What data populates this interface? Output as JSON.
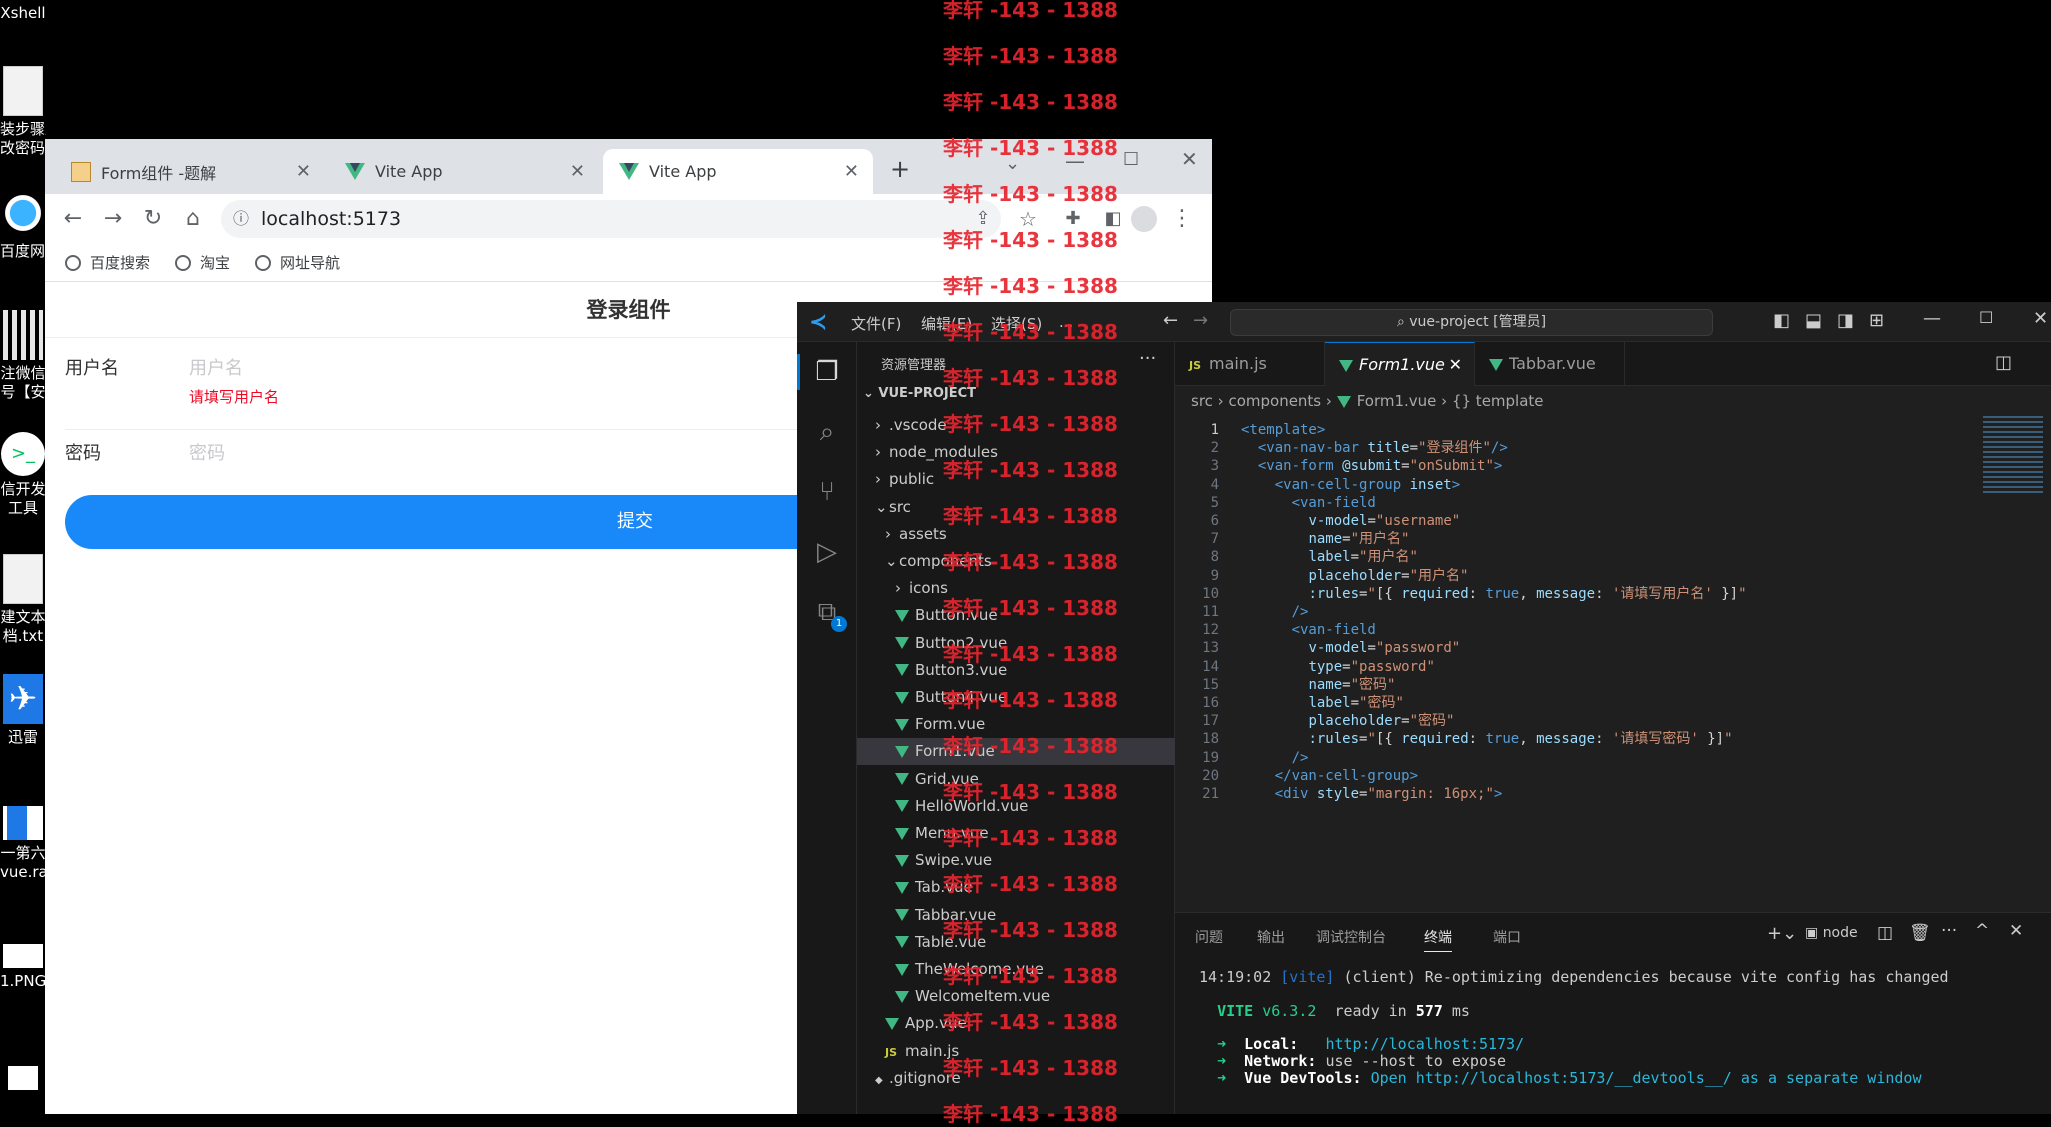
{
  "desktop": {
    "icons": [
      {
        "label": "Xshell",
        "top": 0
      },
      {
        "label": "装步骤及",
        "top": 0
      },
      {
        "label": "改密码.",
        "top": 0
      },
      {
        "label": "百度网盘",
        "top": 0
      },
      {
        "label": "注微信",
        "top": 0
      },
      {
        "label": "号【安",
        "top": 0
      },
      {
        "label": "信开发",
        "top": 0
      },
      {
        "label": "工具",
        "top": 0
      },
      {
        "label": "建文本",
        "top": 0
      },
      {
        "label": "档.txt",
        "top": 0
      },
      {
        "label": "迅雷",
        "top": 0
      },
      {
        "label": "一第六",
        "top": 0
      },
      {
        "label": "vue.rar",
        "top": 0
      },
      {
        "label": "1.PNG",
        "top": 0
      }
    ]
  },
  "browser": {
    "tabs": [
      {
        "title": "Form组件 -题解"
      },
      {
        "title": "Vite App"
      },
      {
        "title": "Vite App"
      }
    ],
    "url": "localhost:5173",
    "bookmarks": [
      "百度搜索",
      "淘宝",
      "网址导航"
    ],
    "page": {
      "navbar_title": "登录组件",
      "username_label": "用户名",
      "username_placeholder": "用户名",
      "username_error": "请填写用户名",
      "password_label": "密码",
      "password_placeholder": "密码",
      "submit_label": "提交"
    }
  },
  "vscode": {
    "menu": [
      "文件(F)",
      "编辑(E)",
      "选择(S)",
      "..."
    ],
    "search_text": "vue-project [管理员]",
    "explorer_title": "资源管理器",
    "project_name": "VUE-PROJECT",
    "tree": [
      {
        "label": ".vscode",
        "depth": 1,
        "kind": "folder",
        "open": false
      },
      {
        "label": "node_modules",
        "depth": 1,
        "kind": "folder",
        "open": false
      },
      {
        "label": "public",
        "depth": 1,
        "kind": "folder",
        "open": false
      },
      {
        "label": "src",
        "depth": 1,
        "kind": "folder",
        "open": true
      },
      {
        "label": "assets",
        "depth": 2,
        "kind": "folder",
        "open": false
      },
      {
        "label": "components",
        "depth": 2,
        "kind": "folder",
        "open": true
      },
      {
        "label": "icons",
        "depth": 3,
        "kind": "folder",
        "open": false
      },
      {
        "label": "Button.vue",
        "depth": 3,
        "kind": "vue"
      },
      {
        "label": "Button2.vue",
        "depth": 3,
        "kind": "vue"
      },
      {
        "label": "Button3.vue",
        "depth": 3,
        "kind": "vue"
      },
      {
        "label": "Button4.vue",
        "depth": 3,
        "kind": "vue"
      },
      {
        "label": "Form.vue",
        "depth": 3,
        "kind": "vue"
      },
      {
        "label": "Form1.vue",
        "depth": 3,
        "kind": "vue",
        "selected": true
      },
      {
        "label": "Grid.vue",
        "depth": 3,
        "kind": "vue"
      },
      {
        "label": "HelloWorld.vue",
        "depth": 3,
        "kind": "vue"
      },
      {
        "label": "Menu.vue",
        "depth": 3,
        "kind": "vue"
      },
      {
        "label": "Swipe.vue",
        "depth": 3,
        "kind": "vue"
      },
      {
        "label": "Tab.vue",
        "depth": 3,
        "kind": "vue"
      },
      {
        "label": "Tabbar.vue",
        "depth": 3,
        "kind": "vue"
      },
      {
        "label": "Table.vue",
        "depth": 3,
        "kind": "vue"
      },
      {
        "label": "TheWelcome.vue",
        "depth": 3,
        "kind": "vue"
      },
      {
        "label": "WelcomeItem.vue",
        "depth": 3,
        "kind": "vue"
      },
      {
        "label": "App.vue",
        "depth": 2,
        "kind": "vue"
      },
      {
        "label": "main.js",
        "depth": 2,
        "kind": "js"
      },
      {
        "label": ".gitignore",
        "depth": 1,
        "kind": "file"
      }
    ],
    "editor_tabs": [
      {
        "label": "main.js",
        "kind": "js"
      },
      {
        "label": "Form1.vue",
        "kind": "vue",
        "active": true
      },
      {
        "label": "Tabbar.vue",
        "kind": "vue"
      }
    ],
    "breadcrumb": [
      "src",
      "components",
      "Form1.vue",
      "{} template"
    ],
    "code_lines": [
      [
        [
          "tg",
          "<template>"
        ]
      ],
      [
        [
          "pu",
          "  "
        ],
        [
          "tg",
          "<van-nav-bar "
        ],
        [
          "at",
          "title"
        ],
        [
          "ck",
          "="
        ],
        [
          "st",
          "\"登录组件\""
        ],
        [
          "tg",
          "/>"
        ]
      ],
      [
        [
          "pu",
          "  "
        ],
        [
          "tg",
          "<van-form "
        ],
        [
          "at",
          "@submit"
        ],
        [
          "ck",
          "="
        ],
        [
          "st",
          "\"onSubmit\""
        ],
        [
          "tg",
          ">"
        ]
      ],
      [
        [
          "pu",
          "    "
        ],
        [
          "tg",
          "<van-cell-group "
        ],
        [
          "at",
          "inset"
        ],
        [
          "tg",
          ">"
        ]
      ],
      [
        [
          "pu",
          "      "
        ],
        [
          "tg",
          "<van-field"
        ]
      ],
      [
        [
          "pu",
          "        "
        ],
        [
          "at",
          "v-model"
        ],
        [
          "ck",
          "="
        ],
        [
          "st",
          "\"username\""
        ]
      ],
      [
        [
          "pu",
          "        "
        ],
        [
          "at",
          "name"
        ],
        [
          "ck",
          "="
        ],
        [
          "st",
          "\"用户名\""
        ]
      ],
      [
        [
          "pu",
          "        "
        ],
        [
          "at",
          "label"
        ],
        [
          "ck",
          "="
        ],
        [
          "st",
          "\"用户名\""
        ]
      ],
      [
        [
          "pu",
          "        "
        ],
        [
          "at",
          "placeholder"
        ],
        [
          "ck",
          "="
        ],
        [
          "st",
          "\"用户名\""
        ]
      ],
      [
        [
          "pu",
          "        "
        ],
        [
          "at",
          ":rules"
        ],
        [
          "ck",
          "="
        ],
        [
          "st",
          "\""
        ],
        [
          "ck",
          "[{ "
        ],
        [
          "at",
          "required"
        ],
        [
          "ck",
          ": "
        ],
        [
          "kw",
          "true"
        ],
        [
          "ck",
          ", "
        ],
        [
          "at",
          "message"
        ],
        [
          "ck",
          ": "
        ],
        [
          "st",
          "'请填写用户名'"
        ],
        [
          "ck",
          " }]"
        ],
        [
          "st",
          "\""
        ]
      ],
      [
        [
          "pu",
          "      "
        ],
        [
          "tg",
          "/>"
        ]
      ],
      [
        [
          "pu",
          "      "
        ],
        [
          "tg",
          "<van-field"
        ]
      ],
      [
        [
          "pu",
          "        "
        ],
        [
          "at",
          "v-model"
        ],
        [
          "ck",
          "="
        ],
        [
          "st",
          "\"password\""
        ]
      ],
      [
        [
          "pu",
          "        "
        ],
        [
          "at",
          "type"
        ],
        [
          "ck",
          "="
        ],
        [
          "st",
          "\"password\""
        ]
      ],
      [
        [
          "pu",
          "        "
        ],
        [
          "at",
          "name"
        ],
        [
          "ck",
          "="
        ],
        [
          "st",
          "\"密码\""
        ]
      ],
      [
        [
          "pu",
          "        "
        ],
        [
          "at",
          "label"
        ],
        [
          "ck",
          "="
        ],
        [
          "st",
          "\"密码\""
        ]
      ],
      [
        [
          "pu",
          "        "
        ],
        [
          "at",
          "placeholder"
        ],
        [
          "ck",
          "="
        ],
        [
          "st",
          "\"密码\""
        ]
      ],
      [
        [
          "pu",
          "        "
        ],
        [
          "at",
          ":rules"
        ],
        [
          "ck",
          "="
        ],
        [
          "st",
          "\""
        ],
        [
          "ck",
          "[{ "
        ],
        [
          "at",
          "required"
        ],
        [
          "ck",
          ": "
        ],
        [
          "kw",
          "true"
        ],
        [
          "ck",
          ", "
        ],
        [
          "at",
          "message"
        ],
        [
          "ck",
          ": "
        ],
        [
          "st",
          "'请填写密码'"
        ],
        [
          "ck",
          " }]"
        ],
        [
          "st",
          "\""
        ]
      ],
      [
        [
          "pu",
          "      "
        ],
        [
          "tg",
          "/>"
        ]
      ],
      [
        [
          "pu",
          "    "
        ],
        [
          "tg",
          "</van-cell-group>"
        ]
      ],
      [
        [
          "pu",
          "    "
        ],
        [
          "tg",
          "<div "
        ],
        [
          "at",
          "style"
        ],
        [
          "ck",
          "="
        ],
        [
          "st",
          "\"margin: 16px;\""
        ],
        [
          "tg",
          ">"
        ]
      ]
    ],
    "panel_tabs": [
      "问题",
      "输出",
      "调试控制台",
      "终端",
      "端口"
    ],
    "panel_active": "终端",
    "terminal_shell": "node",
    "terminal": {
      "line1_time": "14:19:02",
      "line1_tag": "[vite]",
      "line1_rest": " (client) Re-optimizing dependencies because vite config has changed",
      "vite_label": "VITE",
      "vite_version": "v6.3.2",
      "ready_text": "ready in",
      "ready_ms": "577",
      "ready_unit": "ms",
      "local_label": "Local:",
      "local_url": "http://localhost:5173/",
      "network_label": "Network:",
      "network_text": "use --host to expose",
      "devtools_label": "Vue DevTools:",
      "devtools_text": "Open http://localhost:5173/__devtools__/ as a separate window"
    }
  },
  "watermark": {
    "text": "李轩 -143 - 1388"
  },
  "colors": {
    "vant_primary": "#1989fa",
    "vant_danger": "#ee0a24",
    "vue_green": "#41b883",
    "vscode_blue": "#0078d4"
  }
}
